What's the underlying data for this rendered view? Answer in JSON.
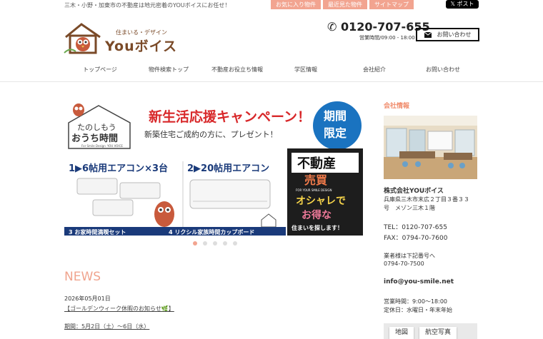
{
  "header": {
    "tagline": "三木・小野・加東市の不動産は地元密着のYOUボイスにお任せ！",
    "top_links": [
      "お気に入り物件",
      "最近見た物件",
      "サイトマップ"
    ],
    "x_post": "ポスト",
    "logo_sub": "住まいる・デザイン",
    "logo_main": "Youボイス",
    "phone": "0120-707-655",
    "hours": "営業時間/09:00 - 18:00",
    "contact_label": "お問い合わせ"
  },
  "nav": [
    "トップページ",
    "物件検索トップ",
    "不動産お役立ち情報",
    "学区情報",
    "会社紹介",
    "お問い合わせ"
  ],
  "banner": {
    "bubble_1": "たのしもう",
    "bubble_2": "おうち時間",
    "bubble_caption": "For Smile Design",
    "brand_small": "YOU VOICE",
    "headline": "新生活応援キャンペーン！",
    "subline": "新築住宅ご成約の方に、プレゼント！",
    "limited_1": "期間",
    "limited_2": "限定",
    "prize_1": "1▶6帖用エアコン×3台",
    "prize_2": "2▶20帖用エアコン",
    "prize_3": "3 お家時間満喫セット",
    "prize_4": "4 リクシル家族時間カップボード",
    "sign_1": "不動産",
    "sign_2": "売買",
    "sign_3": "FOR YOUR SMILE DESIGN",
    "sign_4": "オシャレで",
    "sign_5": "お得な",
    "sign_6": "住まいを探します！"
  },
  "slider": {
    "count": 5,
    "active": 0
  },
  "news": {
    "title": "NEWS",
    "date": "2026年05月01日",
    "link": "【ゴールデンウィーク休暇のお知らせ🌿】",
    "body": "期間：5月2日（土）～6日（水）"
  },
  "sidebar": {
    "title": "会社情報",
    "company": "株式会社YOUボイス",
    "address_1": "兵庫県三木市末広２丁目３番３３",
    "address_2": "号　メゾン三木１階",
    "tel": "TEL：0120-707-655",
    "fax": "FAX：0794-70-7600",
    "biz_note": "業者様は下記番号へ",
    "biz_tel": "0794-70-7500",
    "email": "info@you-smile.net",
    "hours": "営業時間：9:00～18:00",
    "holiday": "定休日：水曜日・年末年始",
    "map_tab": "地図",
    "aerial_tab": "航空写真"
  },
  "colors": {
    "accent": "#f2a490",
    "brand": "#7a4a28",
    "banner_red": "#d8282a",
    "banner_blue": "#1a73c0"
  }
}
